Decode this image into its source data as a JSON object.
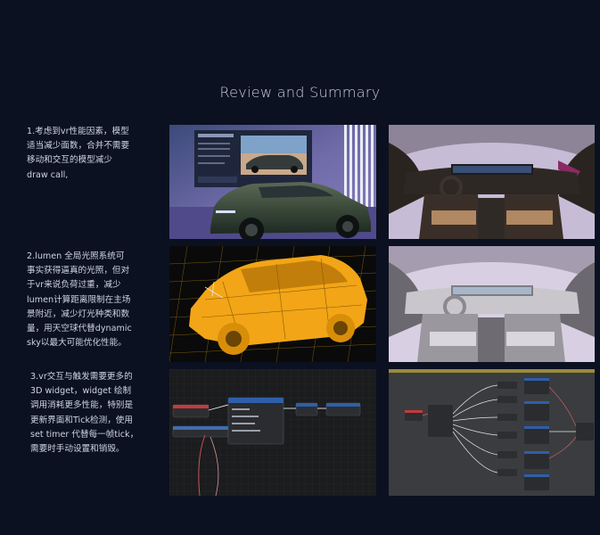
{
  "page": {
    "title": "Review and Summary"
  },
  "notes": [
    {
      "text": "1.考虑到vr性能因素，模型\n适当减少面数，合并不需要\n移动和交互的模型减少\ndraw call,"
    },
    {
      "text": "2.lumen 全局光照系统可\n事实获得逼真的光照，但对\n于vr来说负荷过重，减少\nlumen计算距离限制在主场\n景附近，减少灯光种类和数\n量，用天空球代替dynamic\nsky以最大可能优化性能。"
    },
    {
      "text": "3.vr交互与触发需要更多的\n3D widget，widget 绘制\n调用消耗更多性能，特别是\n更新界面和Tick检测，使用\nset timer 代替每一帧tick，\n需要时手动设置和销毁。"
    }
  ],
  "images": [
    {
      "icon": "car-showroom-render-image"
    },
    {
      "icon": "car-interior-dark-render-image"
    },
    {
      "icon": "car-wireframe-render-image"
    },
    {
      "icon": "car-interior-light-render-image"
    },
    {
      "icon": "blueprint-graph-image"
    },
    {
      "icon": "blueprint-graph-wide-image"
    }
  ],
  "colors": {
    "background": "#0b1121",
    "text": "#cdd3de",
    "wireframe": "#f2a516",
    "blueprint_bg": "#1b1c1e"
  }
}
